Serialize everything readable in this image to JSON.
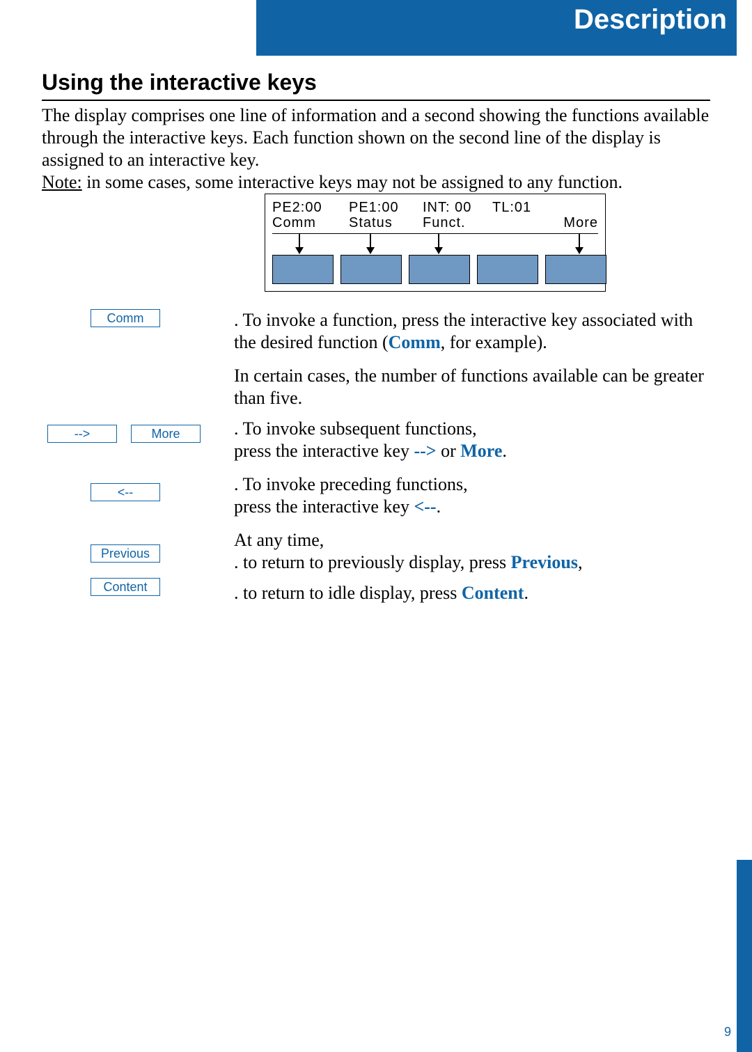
{
  "header": {
    "tab_title": "Description"
  },
  "section": {
    "heading": "Using the interactive keys"
  },
  "intro": {
    "para1": "The display comprises one line of information and a second showing the functions available through the interactive keys. Each function shown on the second line of the display is assigned to an interactive key.",
    "note_label": "Note:",
    "note_text": " in some cases, some interactive keys may not be assigned to any function."
  },
  "display": {
    "line1": {
      "a": "PE2:00",
      "b": "PE1:00",
      "c": "INT: 00",
      "d": "TL:01"
    },
    "line2": {
      "a": "Comm",
      "b": "Status",
      "c": "Funct.",
      "more": "More"
    }
  },
  "left_keys": {
    "comm": "Comm",
    "next_arrow": "-->",
    "more": "More",
    "prev_arrow": "<--",
    "previous": "Previous",
    "content": "Content"
  },
  "body": {
    "p1a": ". To invoke a function, press the interactive key associated with the desired function (",
    "p1_kw": "Comm",
    "p1b": ", for example).",
    "p2": "In certain cases, the number of functions available can be greater than five.",
    "p3a": ". To invoke subsequent functions,",
    "p3b_pre": "press the interactive key ",
    "p3_kw1": "-->",
    "p3_mid": " or ",
    "p3_kw2": "More",
    "p3_end": ".",
    "p4a": ". To invoke preceding functions,",
    "p4b_pre": "press the interactive key ",
    "p4_kw": "<--",
    "p4_end": ".",
    "p5": "At any time,",
    "p6a": ". to return to previously display, press ",
    "p6_kw": "Previous",
    "p6_end": ",",
    "p7a": ". to return to idle display, press ",
    "p7_kw": "Content",
    "p7_end": "."
  },
  "page_number": "9"
}
